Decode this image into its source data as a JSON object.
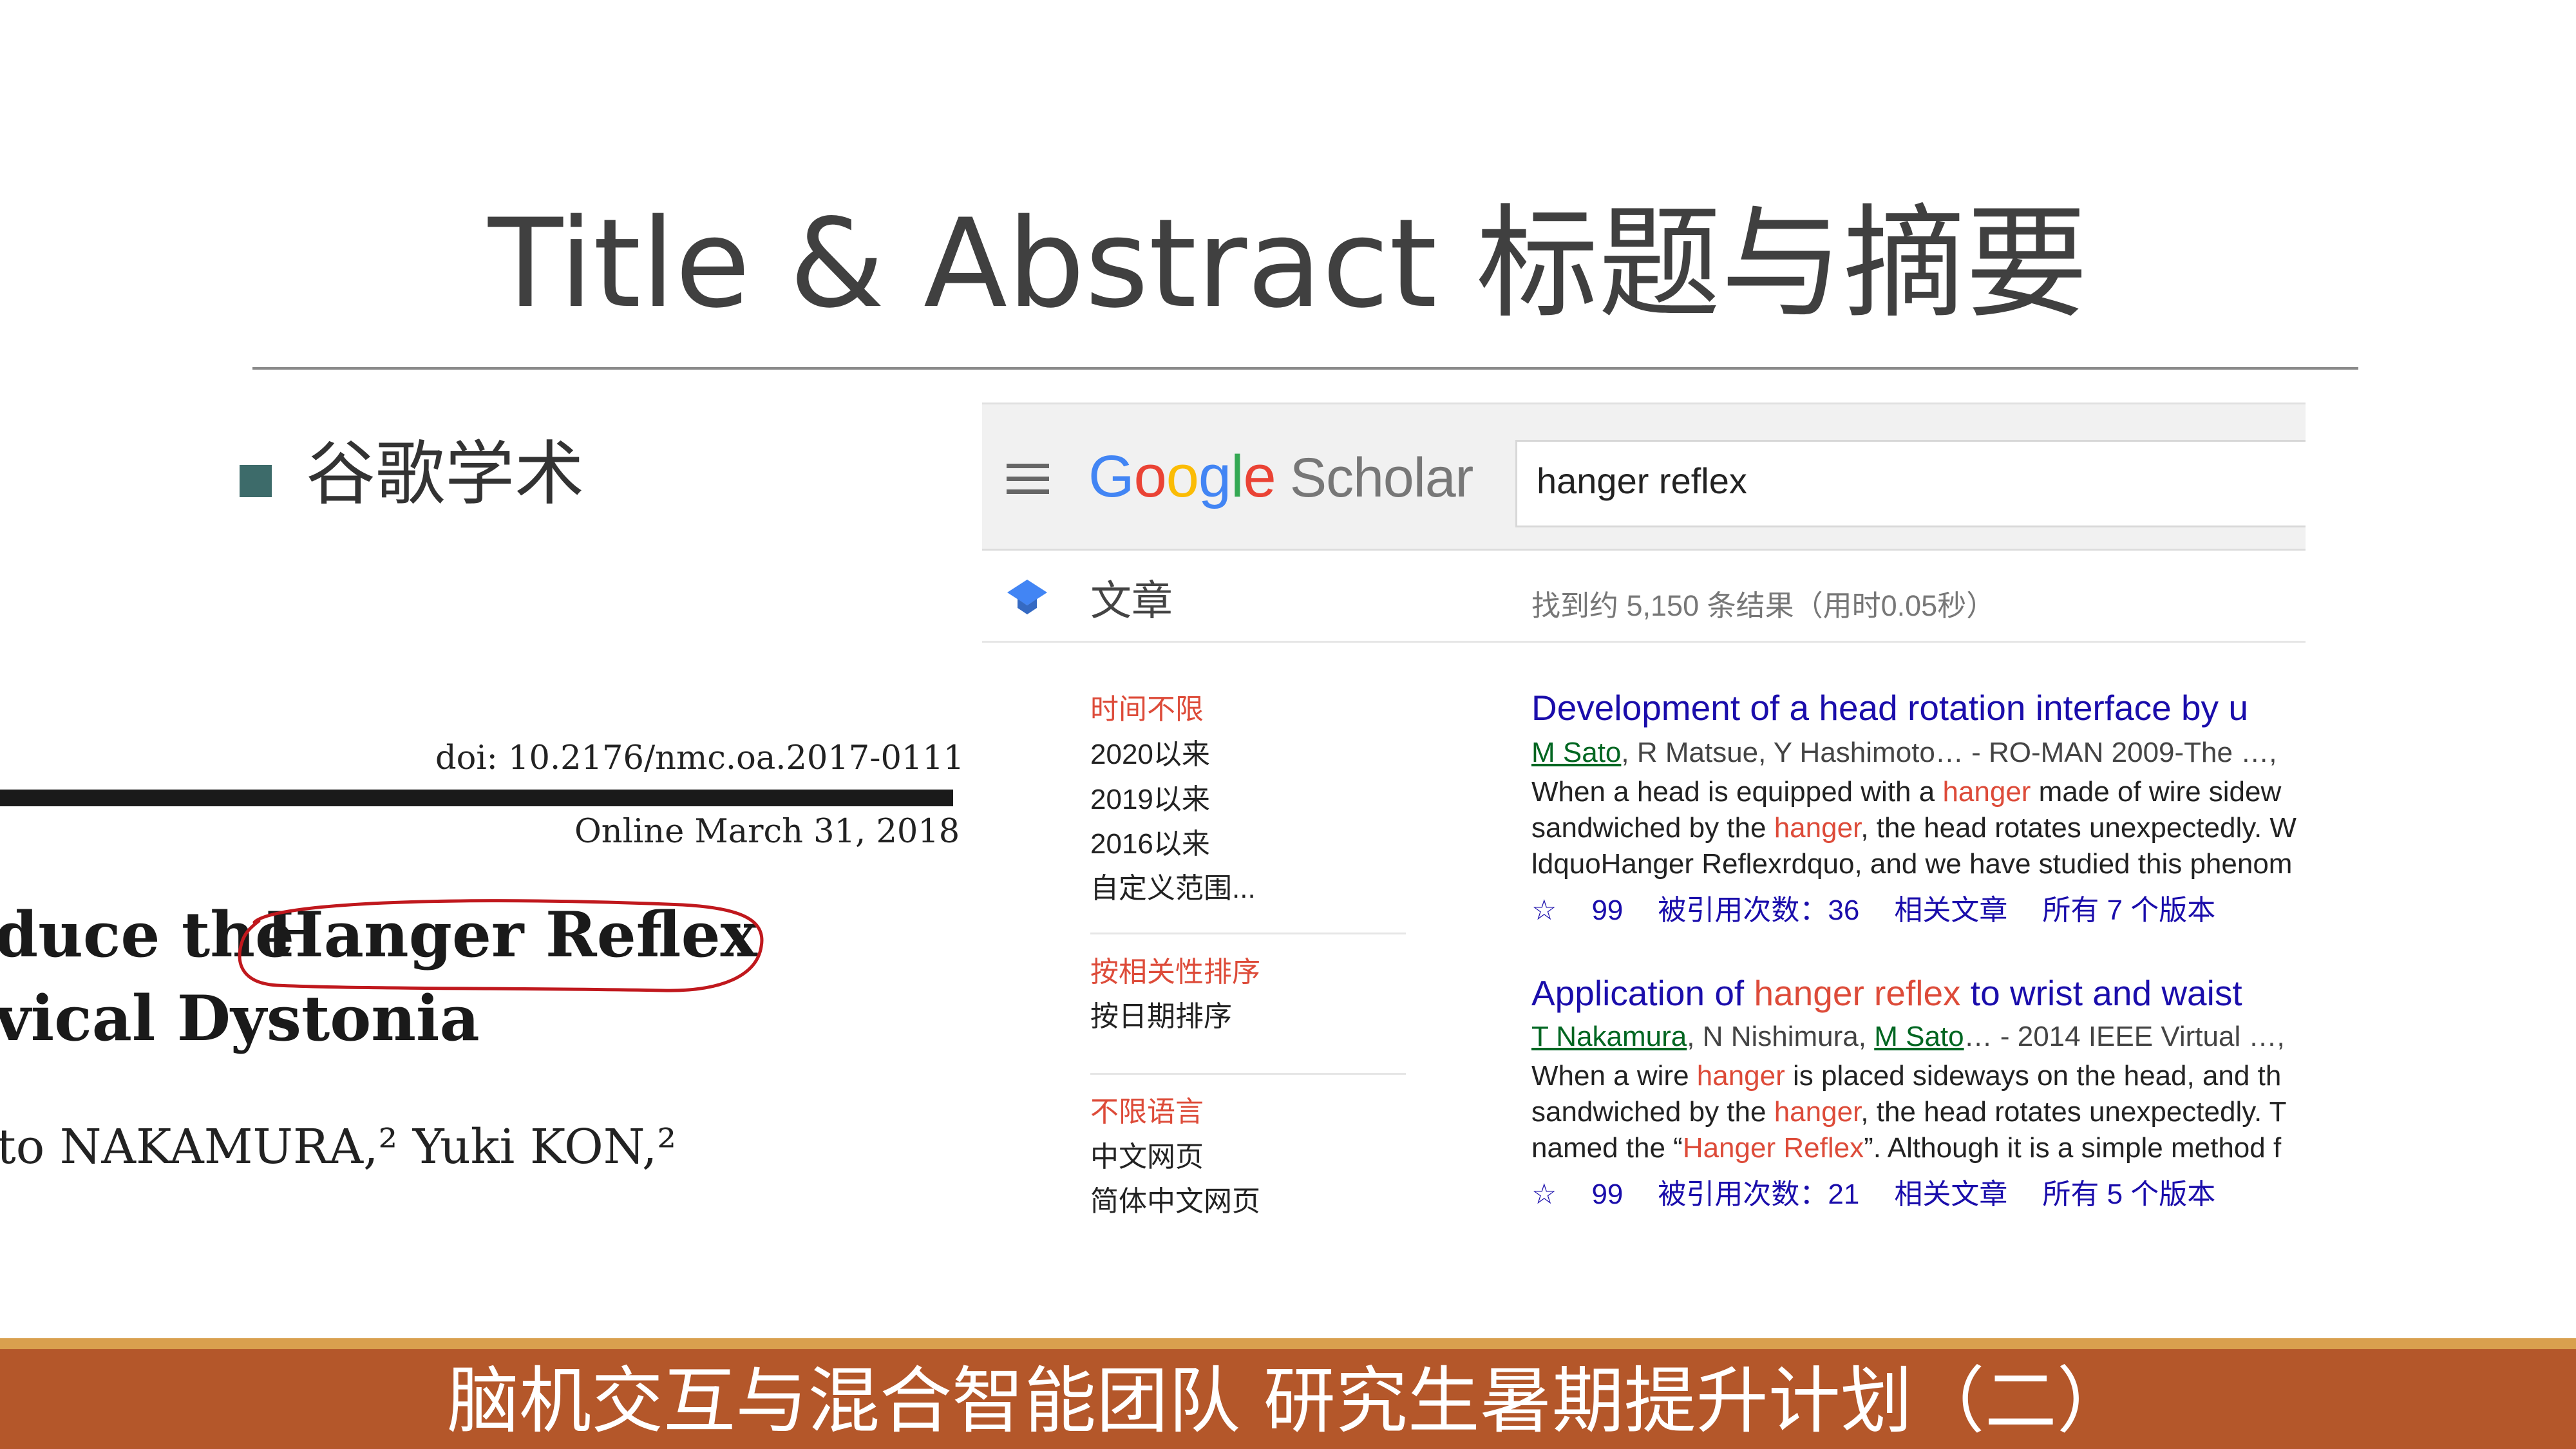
{
  "slide": {
    "title": "Title & Abstract 标题与摘要",
    "bullet": "谷歌学术",
    "footer": "脑机交互与混合智能团队 研究生暑期提升计划（二）"
  },
  "paper": {
    "doi": "doi: 10.2176/nmc.oa.2017-0111",
    "online": "Online March 31, 2018",
    "title_line1_prefix": "duce the",
    "title_line1_highlight": "Hanger Reflex",
    "title_line2": "vical Dystonia",
    "authors": "to NAKAMURA,² Yuki KON,²"
  },
  "scholar": {
    "search_query": "hanger reflex",
    "logo_letters": [
      "G",
      "o",
      "o",
      "g",
      "l",
      "e"
    ],
    "logo_colors": [
      "#4285f4",
      "#ea4335",
      "#fbbc05",
      "#4285f4",
      "#34a853",
      "#ea4335"
    ],
    "logo_scholar": "Scholar",
    "nav_label": "文章",
    "results_count": "找到约 5,150 条结果（用时0.05秒）",
    "sidebar": {
      "time_any": "时间不限",
      "since_2020": "2020以来",
      "since_2019": "2019以来",
      "since_2016": "2016以来",
      "custom_range": "自定义范围...",
      "sort_relevance": "按相关性排序",
      "sort_date": "按日期排序",
      "lang_any": "不限语言",
      "lang_chinese": "中文网页",
      "lang_simplified": "简体中文网页"
    },
    "results": [
      {
        "title": "Development of a head rotation interface by u",
        "author1": "M Sato",
        "meta_rest": ", R Matsue, Y Hashimoto… - RO-MAN 2009-The …,",
        "s1a": "When a head is equipped with a ",
        "s1b": "hanger",
        "s1c": " made of wire sidew",
        "s2a": "sandwiched by the ",
        "s2b": "hanger",
        "s2c": ", the head rotates unexpectedly. W",
        "s3": "ldquoHanger Reflexrdquo, and we have studied this phenom",
        "star": "☆",
        "quote": "99",
        "cited": "被引用次数：36",
        "related": "相关文章",
        "versions": "所有 7 个版本"
      },
      {
        "title_a": "Application of ",
        "title_b": "hanger reflex",
        "title_c": " to wrist and waist",
        "author1": "T Nakamura",
        "meta_mid": ", N Nishimura, ",
        "author3": "M Sato",
        "meta_rest": "… - 2014 IEEE Virtual …,",
        "s1a": "When a wire ",
        "s1b": "hanger",
        "s1c": " is placed sideways on the head, and th",
        "s2a": "sandwiched by the ",
        "s2b": "hanger",
        "s2c": ", the head rotates unexpectedly. T",
        "s3a": "named the “",
        "s3b": "Hanger Reflex",
        "s3c": "”. Although it is a simple method f",
        "star": "☆",
        "quote": "99",
        "cited": "被引用次数：21",
        "related": "相关文章",
        "versions": "所有 5 个版本"
      }
    ]
  },
  "colors": {
    "footer_bg": "#b4572a",
    "footer_stripe": "#d9a04e",
    "bullet": "#3d6b6a",
    "link": "#1a0dab",
    "highlight": "#dd4b39",
    "author_link": "#006621"
  }
}
